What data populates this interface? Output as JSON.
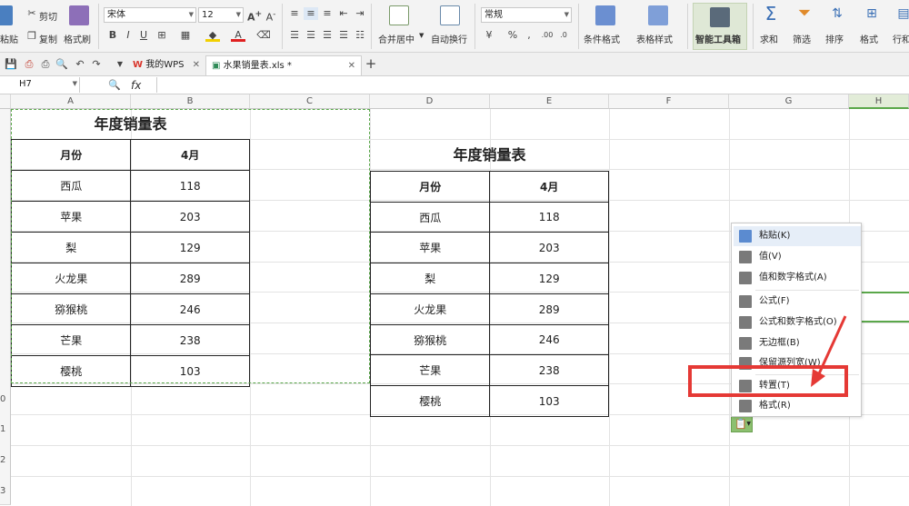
{
  "ribbon": {
    "paste_label": "粘贴",
    "cut_label": "剪切",
    "copy_label": "复制",
    "format_painter_label": "格式刷",
    "font_name": "宋体",
    "font_size": "12",
    "merge_label": "合并居中",
    "wrap_label": "自动换行",
    "number_format": "常规",
    "conditional_format_label": "条件格式",
    "table_style_label": "表格样式",
    "smart_toolbox_label": "智能工具箱",
    "sum_label": "求和",
    "filter_label": "筛选",
    "sort_label": "排序",
    "format_label": "格式",
    "rowcol_label": "行和"
  },
  "tabs": [
    {
      "label": "我的WPS"
    },
    {
      "label": "水果销量表.xls *"
    }
  ],
  "formula_bar": {
    "cell_ref": "H7",
    "fx_label": "fx",
    "value": ""
  },
  "columns": [
    "A",
    "B",
    "C",
    "D",
    "E",
    "F",
    "G",
    "H"
  ],
  "row_numbers": [
    "0",
    "1",
    "2",
    "3"
  ],
  "left_table": {
    "title": "年度销量表",
    "headers": [
      "月份",
      "4月"
    ],
    "rows": [
      [
        "西瓜",
        "118"
      ],
      [
        "苹果",
        "203"
      ],
      [
        "梨",
        "129"
      ],
      [
        "火龙果",
        "289"
      ],
      [
        "猕猴桃",
        "246"
      ],
      [
        "芒果",
        "238"
      ],
      [
        "樱桃",
        "103"
      ]
    ]
  },
  "right_table": {
    "title": "年度销量表",
    "headers": [
      "月份",
      "4月"
    ],
    "rows": [
      [
        "西瓜",
        "118"
      ],
      [
        "苹果",
        "203"
      ],
      [
        "梨",
        "129"
      ],
      [
        "火龙果",
        "289"
      ],
      [
        "猕猴桃",
        "246"
      ],
      [
        "芒果",
        "238"
      ],
      [
        "樱桃",
        "103"
      ]
    ]
  },
  "paste_menu": {
    "items": [
      {
        "label": "粘贴(K)",
        "icon": "paste-icon"
      },
      {
        "label": "值(V)",
        "icon": "values-icon"
      },
      {
        "label": "值和数字格式(A)",
        "icon": "values-number-format-icon"
      },
      {
        "label": "公式(F)",
        "icon": "formula-icon"
      },
      {
        "label": "公式和数字格式(O)",
        "icon": "formula-number-format-icon"
      },
      {
        "label": "无边框(B)",
        "icon": "no-border-icon"
      },
      {
        "label": "保留源列宽(W)",
        "icon": "keep-width-icon"
      },
      {
        "label": "转置(T)",
        "icon": "transpose-icon"
      },
      {
        "label": "格式(R)",
        "icon": "format-icon"
      }
    ]
  },
  "colors": {
    "accent_green": "#5aa74a",
    "highlight_red": "#e53935",
    "wps_red": "#d9352b"
  }
}
